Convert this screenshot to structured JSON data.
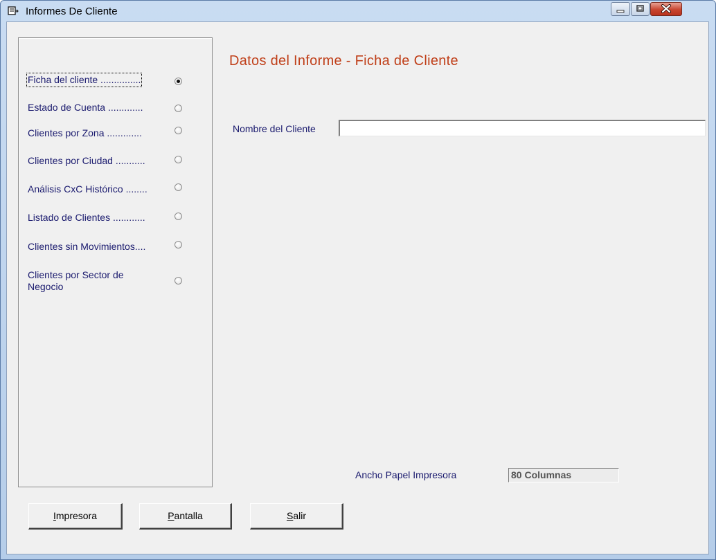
{
  "window": {
    "title": "Informes De Cliente",
    "icon": "report-app-icon",
    "controls": [
      "minimize-icon",
      "maximize-icon",
      "close-icon"
    ],
    "close_color": "#c8452f"
  },
  "report_options": [
    {
      "label": "Ficha del cliente ...............",
      "mnemonic": "F",
      "selected": true
    },
    {
      "label": "Estado de Cuenta .............",
      "mnemonic": "E",
      "selected": false
    },
    {
      "label": "Clientes por Zona .............",
      "mnemonic": "C",
      "selected": false
    },
    {
      "label": "Clientes por Ciudad ...........",
      "mnemonic": "l",
      "selected": false
    },
    {
      "label": "Análisis CxC Histórico ........",
      "mnemonic": "A",
      "selected": false
    },
    {
      "label": "Listado de Clientes ............",
      "mnemonic": "L",
      "selected": false
    },
    {
      "label": "Clientes sin Movimientos....",
      "mnemonic": "n",
      "selected": false
    },
    {
      "label": "Clientes por Sector de\nNegocio",
      "mnemonic": "t",
      "selected": false
    }
  ],
  "report_panel": {
    "heading": "Datos del Informe - Ficha de Cliente",
    "heading_color": "#c0401a",
    "client_name_label": "Nombre del Cliente",
    "client_name_value": "",
    "paper_width_label": "Ancho Papel Impresora",
    "paper_width_value": "80 Columnas"
  },
  "buttons": {
    "printer": {
      "pre": "",
      "key": "I",
      "post": "mpresora"
    },
    "screen": {
      "pre": "",
      "key": "P",
      "post": "antalla"
    },
    "exit": {
      "pre": "",
      "key": "S",
      "post": "alir"
    }
  },
  "colors": {
    "label_text": "#1a1a6e",
    "dialog_bg": "#f0f0f0"
  }
}
